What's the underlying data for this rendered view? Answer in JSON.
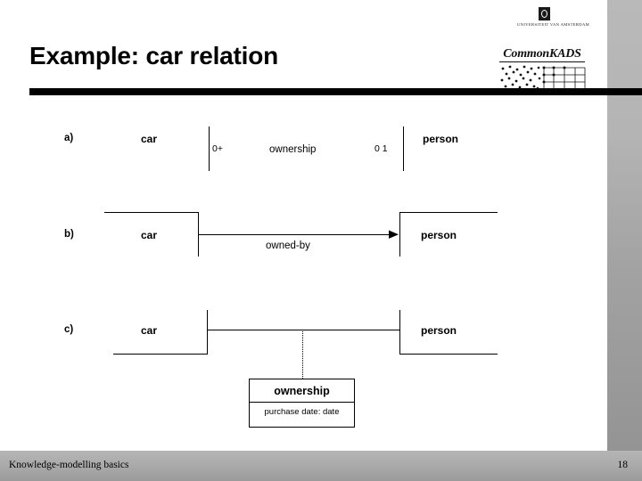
{
  "slide": {
    "title": "Example: car relation",
    "logos": {
      "university_name": "UNIVERSITEIT VAN AMSTERDAM",
      "methodology_name": "CommonKADS"
    },
    "footer": {
      "text": "Knowledge-modelling basics",
      "page_number": "18"
    },
    "colors": {
      "rule": "#000000",
      "band": "#a8a8a8",
      "footer": "#aaaaaa"
    }
  },
  "diagram": {
    "rows": [
      {
        "label": "a)",
        "left_entity": "car",
        "right_entity": "person",
        "relation": "ownership",
        "left_cardinality": "0+",
        "right_cardinality": "0 1"
      },
      {
        "label": "b)",
        "left_entity": "car",
        "right_entity": "person",
        "relation": "owned-by",
        "left_cardinality": "",
        "right_cardinality": ""
      },
      {
        "label": "c)",
        "left_entity": "car",
        "right_entity": "person",
        "relation": "",
        "left_cardinality": "",
        "right_cardinality": ""
      }
    ],
    "association_class": {
      "name": "ownership",
      "attribute": "purchase date: date"
    }
  }
}
